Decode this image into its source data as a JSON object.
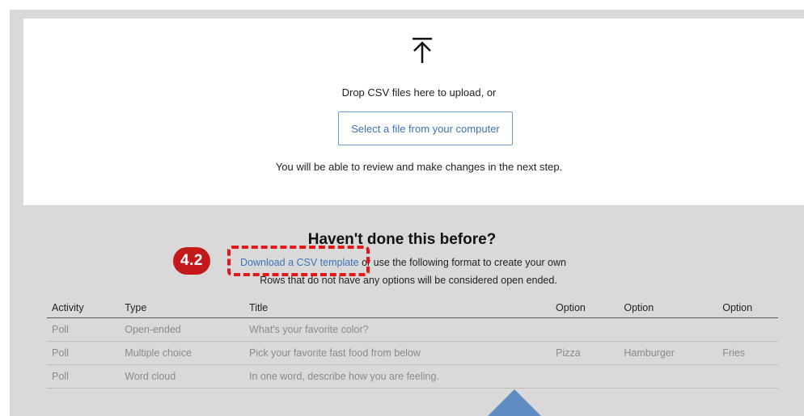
{
  "upload": {
    "icon": "upload-arrow-icon",
    "drop_text": "Drop CSV files here to upload, or",
    "select_button": "Select a file from your computer",
    "review_text": "You will be able to review and make changes in the next step."
  },
  "help": {
    "title": "Haven't done this before?",
    "template_link": "Download a CSV template",
    "format_text": " or use the following format to create your own",
    "rows_note": "Rows that do not have any options will be considered open ended."
  },
  "annotation": {
    "badge": "4.2",
    "badge_color": "#c3191a",
    "highlight_color": "#e11919"
  },
  "table": {
    "headers": [
      "Activity",
      "Type",
      "Title",
      "Option",
      "Option",
      "Option"
    ],
    "rows": [
      [
        "Poll",
        "Open-ended",
        "What's your favorite color?",
        "",
        "",
        ""
      ],
      [
        "Poll",
        "Multiple choice",
        "Pick your favorite fast food from below",
        "Pizza",
        "Hamburger",
        "Fries"
      ],
      [
        "Poll",
        "Word cloud",
        "In one word, describe how you are feeling.",
        "",
        "",
        ""
      ]
    ]
  },
  "colors": {
    "accent": "#3b74b6",
    "pointer": "#5e8cc1",
    "background": "#d9d9d9"
  }
}
